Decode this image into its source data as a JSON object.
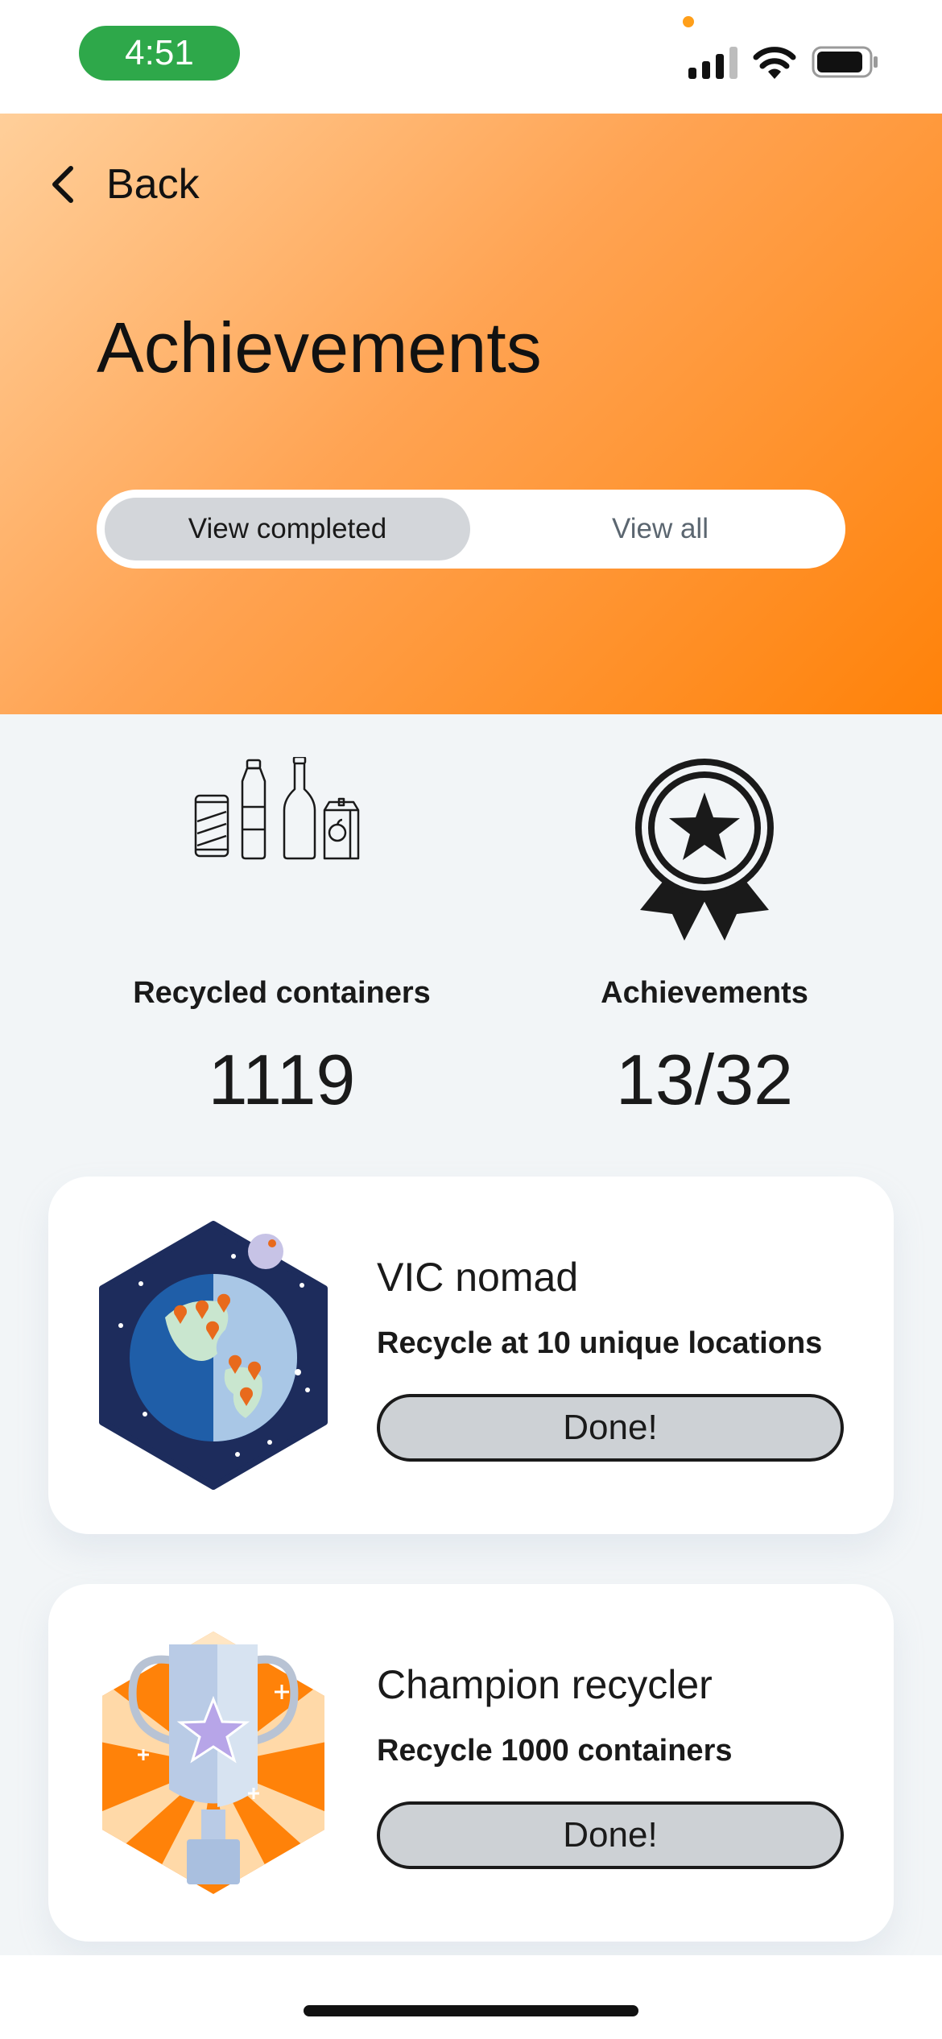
{
  "status_bar": {
    "time": "4:51",
    "icons": [
      "cellular-signal-icon",
      "wifi-icon",
      "battery-icon"
    ],
    "colors": {
      "time_pill": "#2ea84a",
      "privacy_dot": "#ff9f1a"
    }
  },
  "header": {
    "back_label": "Back",
    "title": "Achievements",
    "gradient": [
      "#ffcf9a",
      "#ff8209"
    ],
    "segmented": {
      "completed_label": "View completed",
      "all_label": "View all",
      "selected": "View completed"
    }
  },
  "stats": {
    "recycled": {
      "label": "Recycled containers",
      "value": "1119",
      "icon": "containers-icon"
    },
    "achievements": {
      "label": "Achievements",
      "value": "13/32",
      "icon": "award-medal-icon"
    }
  },
  "cards": [
    {
      "title": "VIC nomad",
      "description": "Recycle at 10 unique locations",
      "button_label": "Done!",
      "badge_icon": "globe-badge-icon"
    },
    {
      "title": "Champion recycler",
      "description": "Recycle 1000 containers",
      "button_label": "Done!",
      "badge_icon": "trophy-badge-icon"
    }
  ]
}
